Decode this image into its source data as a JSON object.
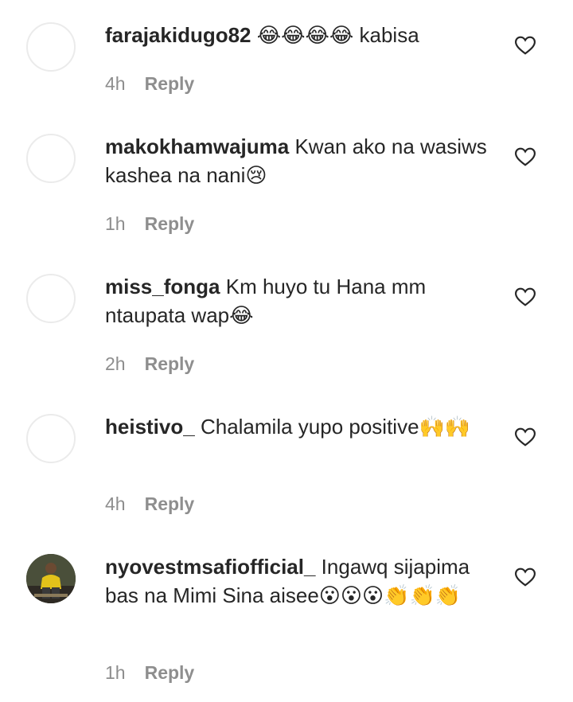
{
  "comments": [
    {
      "username": "farajakidugo82",
      "text": "😂😂😂😂 kabisa",
      "time": "4h",
      "reply_label": "Reply",
      "avatar": "blank"
    },
    {
      "username": "makokhamwajuma",
      "text": "Kwan ako na wasiws kashea na nani😢",
      "time": "1h",
      "reply_label": "Reply",
      "avatar": "blank"
    },
    {
      "username": "miss_fonga",
      "text": "Km huyo tu Hana mm ntaupata wap😂",
      "time": "2h",
      "reply_label": "Reply",
      "avatar": "blank"
    },
    {
      "username": "heistivo_",
      "text": "Chalamila yupo positive🙌🙌",
      "time": "4h",
      "reply_label": "Reply",
      "avatar": "blank"
    },
    {
      "username": "nyovestmsafiofficial_",
      "text": "Ingawq sijapima bas na Mimi Sina aisee😮😮😮👏👏👏",
      "time": "1h",
      "reply_label": "Reply",
      "avatar": "photo"
    }
  ],
  "icons": {
    "like": "heart-outline-icon"
  },
  "colors": {
    "text": "#262626",
    "secondary": "#8e8e8e",
    "avatar_border": "#ebebeb"
  }
}
